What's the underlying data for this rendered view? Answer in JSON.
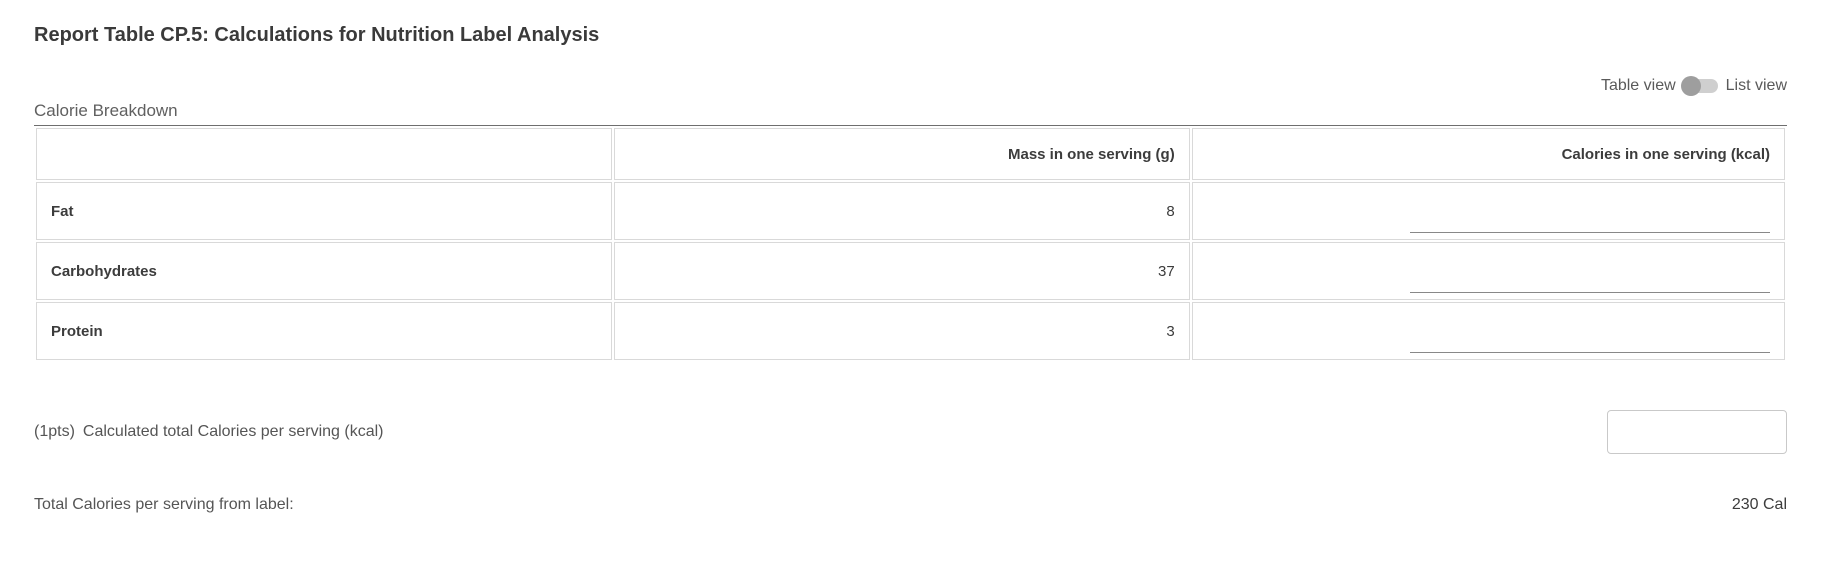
{
  "title": "Report Table CP.5: Calculations for Nutrition Label Analysis",
  "view_toggle": {
    "left": "Table view",
    "right": "List view"
  },
  "section_title": "Calorie Breakdown",
  "table": {
    "headers": [
      "",
      "Mass in one serving (g)",
      "Calories in one serving (kcal)"
    ],
    "rows": [
      {
        "label": "Fat",
        "mass": "8",
        "calories": ""
      },
      {
        "label": "Carbohydrates",
        "mass": "37",
        "calories": ""
      },
      {
        "label": "Protein",
        "mass": "3",
        "calories": ""
      }
    ]
  },
  "question1": {
    "points": "(1pts)",
    "text": "Calculated total Calories per serving (kcal)",
    "value": ""
  },
  "question2": {
    "text": "Total Calories per serving from label:",
    "value": "230 Cal"
  }
}
